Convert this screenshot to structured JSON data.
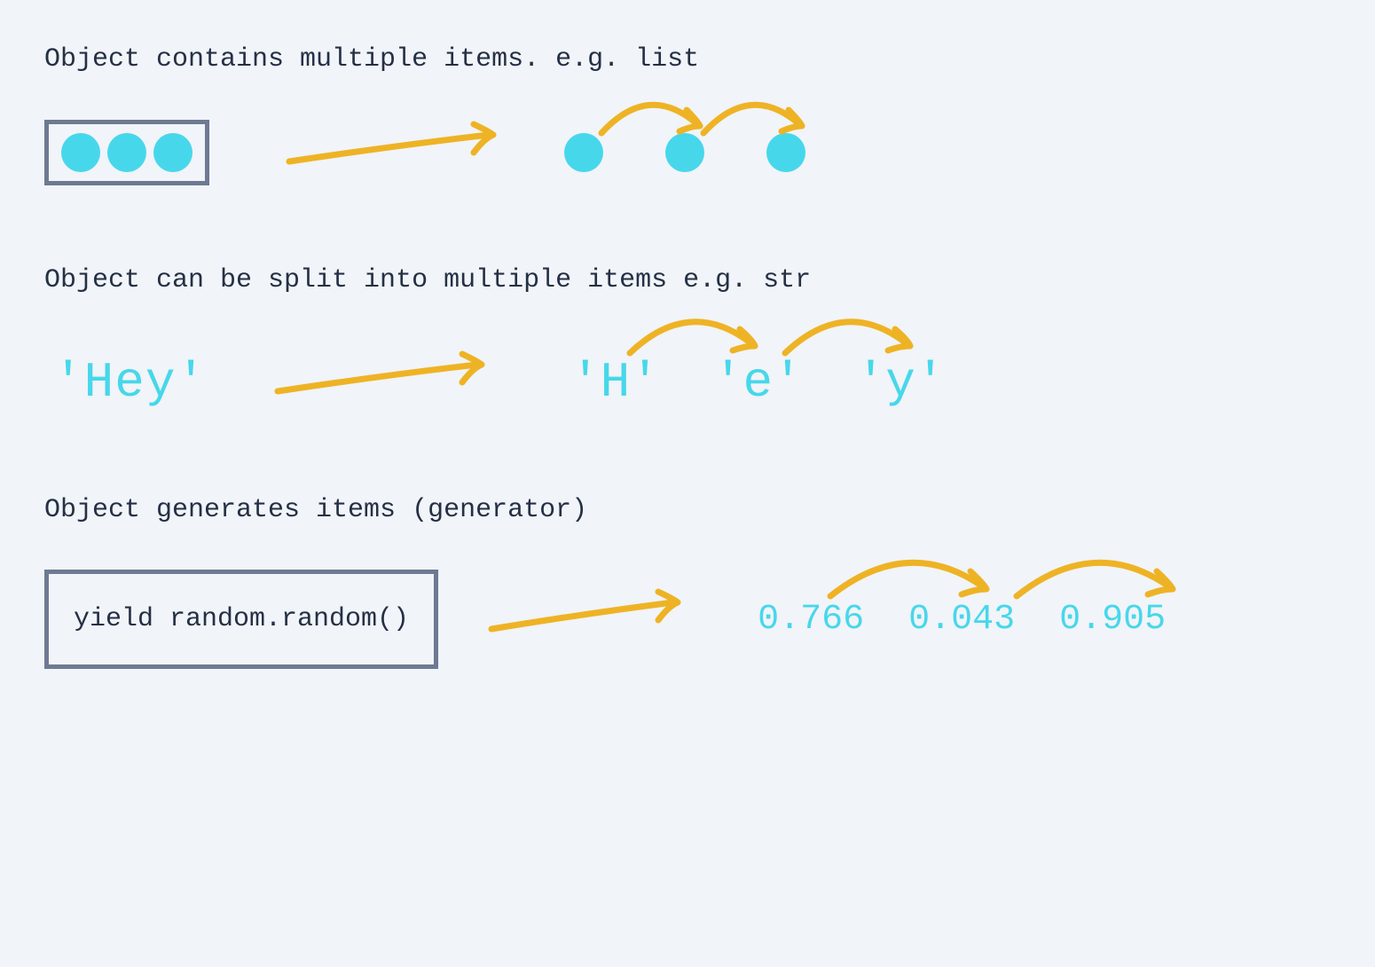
{
  "colors": {
    "bg": "#f1f4f8",
    "text": "#253045",
    "accent": "#47d7eb",
    "border": "#6d7a92",
    "arrow": "#eeb325"
  },
  "section1": {
    "heading": "Object contains multiple items. e.g. list"
  },
  "section2": {
    "heading": "Object can be split into multiple items e.g. str",
    "source": "'Hey'",
    "items": [
      "'H'",
      "'e'",
      "'y'"
    ]
  },
  "section3": {
    "heading": "Object generates items  (generator)",
    "code": "yield random.random()",
    "items": [
      "0.766",
      "0.043",
      "0.905"
    ]
  }
}
